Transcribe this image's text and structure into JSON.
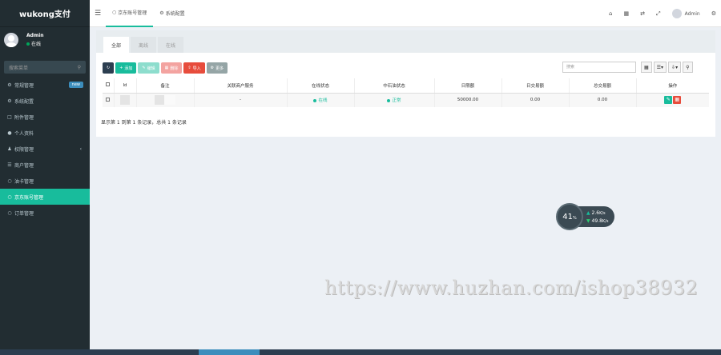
{
  "brand": {
    "title": "wukong支付"
  },
  "user": {
    "name": "Admin",
    "status": "在线"
  },
  "sidebar": {
    "search_placeholder": "搜索菜单",
    "items": [
      {
        "label": "常规管理",
        "icon": "gears-icon",
        "badge": "new"
      },
      {
        "label": "系统配置",
        "icon": "gear-icon"
      },
      {
        "label": "附件管理",
        "icon": "file-icon"
      },
      {
        "label": "个人资料",
        "icon": "user-icon"
      },
      {
        "label": "权限管理",
        "icon": "group-icon",
        "chevron": "‹"
      },
      {
        "label": "商户管理",
        "icon": "list-icon"
      },
      {
        "label": "油卡管理",
        "icon": "circle-icon"
      },
      {
        "label": "京东账号管理",
        "icon": "circle-icon",
        "active": true
      },
      {
        "label": "订单管理",
        "icon": "circle-icon"
      }
    ]
  },
  "topbar": {
    "tabs": [
      {
        "label": "京东账号管理",
        "active": true
      },
      {
        "label": "系统配置",
        "active": false
      }
    ],
    "admin_label": "Admin"
  },
  "panel": {
    "tabs": [
      "全部",
      "离线",
      "在线"
    ]
  },
  "toolbar": {
    "add": "添加",
    "edit": "编辑",
    "delete": "删除",
    "import": "导入",
    "more": "更多"
  },
  "search": {
    "placeholder": "搜索"
  },
  "table": {
    "headers": [
      "Id",
      "备注",
      "关联商户服务",
      "在线状态",
      "中石油状态",
      "日限额",
      "日交易额",
      "总交易额",
      "操作"
    ],
    "rows": [
      {
        "related": "-",
        "online": "在线",
        "cnpc": "正常",
        "daily_limit": "50000.00",
        "daily_amount": "0.00",
        "total_amount": "0.00"
      }
    ]
  },
  "footer": {
    "info": "显示第 1 到第 1 条记录，总共 1 条记录"
  },
  "speed_widget": {
    "percent": "41",
    "unit": "%",
    "up": "2.6",
    "up_unit": "K/s",
    "down": "49.8",
    "down_unit": "K/s"
  },
  "watermark": "https://www.huzhan.com/ishop38932",
  "colors": {
    "accent": "#18bc9c",
    "danger": "#e74c3c",
    "sidebar": "#222d32",
    "dark_btn": "#2c3e50"
  }
}
